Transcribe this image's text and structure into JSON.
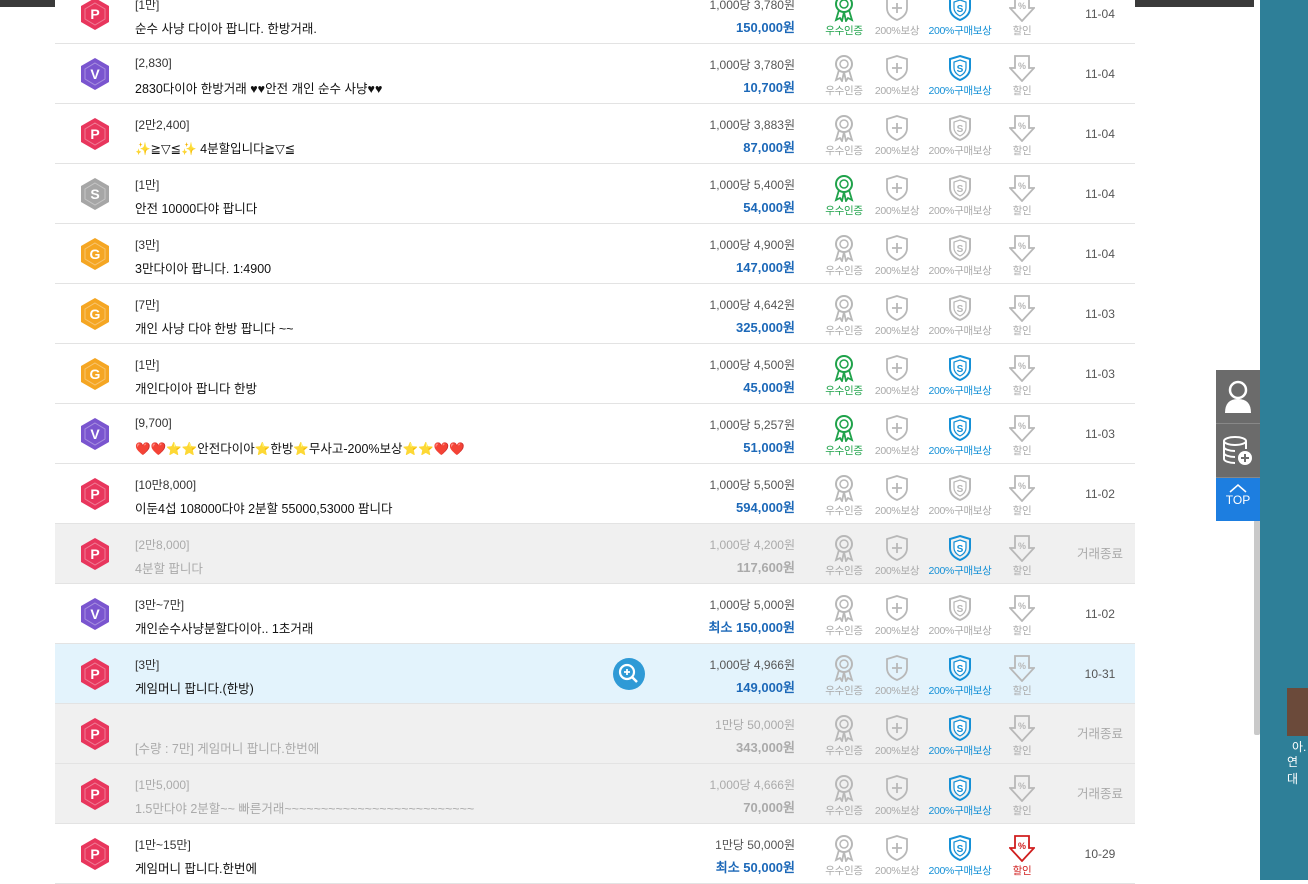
{
  "labels": {
    "excellent": "우수인증",
    "reward200": "200%보상",
    "purchase200": "200%구매보상",
    "discount": "할인"
  },
  "colors": {
    "accent": "#1c68b8",
    "green": "#1fa24a",
    "blue": "#1590d6",
    "red": "#d01e1e",
    "P": "#e8365d",
    "V": "#7a55cf",
    "S": "#a6a6a6",
    "G": "#f5a623"
  },
  "rows": [
    {
      "badge": "P",
      "title": "[1만]",
      "subtitle": "순수 사냥 다이아 팝니다. 한방거래.",
      "rate": "1,000당 3,780원",
      "price": "150,000원",
      "marks": [
        1,
        1,
        1,
        0
      ],
      "date": "11-04",
      "state": "normal"
    },
    {
      "badge": "V",
      "title": "[2,830]",
      "subtitle": "2830다이아 한방거래 ♥♥안전 개인 순수 사냥♥♥",
      "rate": "1,000당 3,780원",
      "price": "10,700원",
      "marks": [
        0,
        0,
        1,
        0
      ],
      "date": "11-04",
      "state": "normal"
    },
    {
      "badge": "P",
      "title": "[2만2,400]",
      "subtitle": "✨≧▽≦✨ 4분할입니다≧▽≦",
      "rate": "1,000당 3,883원",
      "price": "87,000원",
      "marks": [
        0,
        0,
        0,
        0
      ],
      "date": "11-04",
      "state": "normal"
    },
    {
      "badge": "S",
      "title": "[1만]",
      "subtitle": "안전 10000다야 팝니다",
      "rate": "1,000당 5,400원",
      "price": "54,000원",
      "marks": [
        1,
        0,
        0,
        0
      ],
      "date": "11-04",
      "state": "normal"
    },
    {
      "badge": "G",
      "title": "[3만]",
      "subtitle": "3만다이아 팝니다. 1:4900",
      "rate": "1,000당 4,900원",
      "price": "147,000원",
      "marks": [
        0,
        0,
        0,
        0
      ],
      "date": "11-04",
      "state": "normal"
    },
    {
      "badge": "G",
      "title": "[7만]",
      "subtitle": "개인 사냥 다야 한방 팝니다 ~~",
      "rate": "1,000당 4,642원",
      "price": "325,000원",
      "marks": [
        0,
        0,
        0,
        0
      ],
      "date": "11-03",
      "state": "normal"
    },
    {
      "badge": "G",
      "title": "[1만]",
      "subtitle": "개인다이아 팝니다 한방",
      "rate": "1,000당 4,500원",
      "price": "45,000원",
      "marks": [
        1,
        0,
        1,
        0
      ],
      "date": "11-03",
      "state": "normal"
    },
    {
      "badge": "V",
      "title": "[9,700]",
      "subtitle": "❤️❤️⭐⭐안전다이아⭐한방⭐무사고-200%보상⭐⭐❤️❤️",
      "rate": "1,000당 5,257원",
      "price": "51,000원",
      "marks": [
        1,
        0,
        1,
        0
      ],
      "date": "11-03",
      "state": "normal"
    },
    {
      "badge": "P",
      "title": "[10만8,000]",
      "subtitle": "이둔4섭 108000다야 2분할 55000,53000 팜니다",
      "rate": "1,000당 5,500원",
      "price": "594,000원",
      "marks": [
        0,
        0,
        0,
        0
      ],
      "date": "11-02",
      "state": "normal"
    },
    {
      "badge": "P",
      "title": "[2만8,000]",
      "subtitle": "4분할 팝니다",
      "rate": "1,000당 4,200원",
      "price": "117,600원",
      "marks": [
        0,
        0,
        1,
        0
      ],
      "date": "거래종료",
      "state": "ended"
    },
    {
      "badge": "V",
      "title": "[3만~7만]",
      "subtitle": "개인순수사냥분할다이아.. 1초거래",
      "rate": "1,000당 5,000원",
      "price": "최소 150,000원",
      "marks": [
        0,
        0,
        0,
        0
      ],
      "date": "11-02",
      "state": "normal"
    },
    {
      "badge": "P",
      "title": "[3만]",
      "subtitle": "게임머니 팝니다.(한방)",
      "rate": "1,000당 4,966원",
      "price": "149,000원",
      "marks": [
        0,
        0,
        1,
        0
      ],
      "date": "10-31",
      "state": "hl"
    },
    {
      "badge": "P",
      "title": "",
      "subtitle": "[수량 : 7만] 게임머니 팝니다.한번에",
      "rate": "1만당 50,000원",
      "price": "343,000원",
      "marks": [
        0,
        0,
        1,
        0
      ],
      "date": "거래종료",
      "state": "ended"
    },
    {
      "badge": "P",
      "title": "[1만5,000]",
      "subtitle": "1.5만다야 2분할~~ 빠른거래~~~~~~~~~~~~~~~~~~~~~~~~~~",
      "rate": "1,000당 4,666원",
      "price": "70,000원",
      "marks": [
        0,
        0,
        1,
        0
      ],
      "date": "거래종료",
      "state": "ended"
    },
    {
      "badge": "P",
      "title": "[1만~15만]",
      "subtitle": "게임머니 팝니다.한번에",
      "rate": "1만당 50,000원",
      "price": "최소 50,000원",
      "marks": [
        0,
        0,
        1,
        1
      ],
      "date": "10-29",
      "state": "normal"
    }
  ],
  "quickmenu": {
    "top": "TOP"
  },
  "desktop": {
    "line1": "아.",
    "line2": "연대"
  }
}
